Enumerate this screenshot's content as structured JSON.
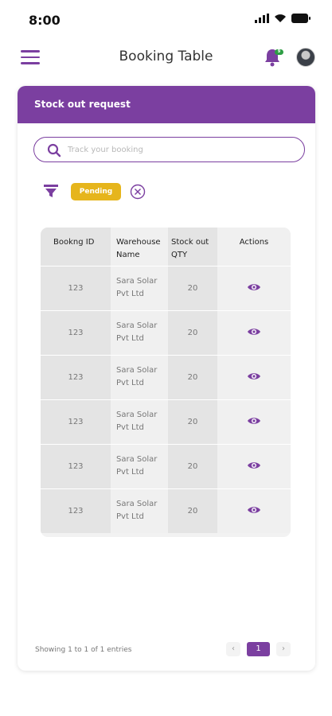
{
  "status_bar": {
    "time": "8:00"
  },
  "header": {
    "title": "Booking Table",
    "notification_count": "9"
  },
  "card": {
    "title": "Stock out request",
    "search": {
      "placeholder": "Track your booking",
      "value": ""
    },
    "filter": {
      "status_label": "Pending"
    }
  },
  "table": {
    "columns": [
      "Bookng ID",
      "Warehouse Name",
      "Stock out QTY",
      "Actions"
    ],
    "rows": [
      {
        "id": "123",
        "warehouse": "Sara Solar Pvt Ltd",
        "qty": "20",
        "action": "view-icon"
      },
      {
        "id": "123",
        "warehouse": "Sara Solar Pvt Ltd",
        "qty": "20",
        "action": "view-icon"
      },
      {
        "id": "123",
        "warehouse": "Sara Solar Pvt Ltd",
        "qty": "20",
        "action": "view-icon"
      },
      {
        "id": "123",
        "warehouse": "Sara Solar Pvt Ltd",
        "qty": "20",
        "action": "view-icon"
      },
      {
        "id": "123",
        "warehouse": "Sara Solar Pvt Ltd",
        "qty": "20",
        "action": "view-icon"
      },
      {
        "id": "123",
        "warehouse": "Sara Solar Pvt Ltd",
        "qty": "20",
        "action": "view-icon"
      }
    ]
  },
  "footer": {
    "entries_text": "Showing 1 to 1 of 1 entries",
    "prev": "‹",
    "current_page": "1",
    "next": "›"
  },
  "colors": {
    "accent": "#7b3fa0",
    "pending": "#e6b51c",
    "badge": "#2e9e45"
  }
}
